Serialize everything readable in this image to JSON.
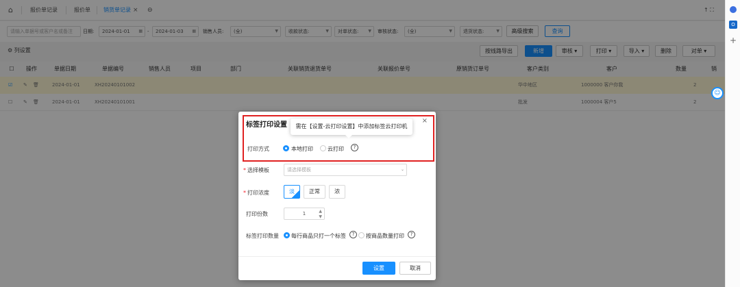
{
  "tabs": {
    "home": "⌂",
    "t1": "报价单记录",
    "t2": "报价单",
    "t3": "销货单记录",
    "close": "×",
    "add": "⊖",
    "right": "↑ ⛶"
  },
  "filter": {
    "search_placeholder": "请输入单据号或客户名或备注",
    "date_label": "日期:",
    "date_from": "2024-01-01",
    "date_sep": "-",
    "date_to": "2024-01-03",
    "sales_label": "销售人员:",
    "sales_value": "(全)",
    "collect_label": "收款状态:",
    "check_label": "对单状态:",
    "audit_label": "审核状态:",
    "audit_value": "(全)",
    "return_label": "退货状态:",
    "advanced": "高级搜索",
    "query": "查询"
  },
  "toolbar": {
    "col_settings": "列设置",
    "export": "按线路导出",
    "new": "新增",
    "audit": "审核",
    "print": "打印",
    "import": "导入",
    "delete": "删除",
    "check": "对单"
  },
  "table": {
    "headers": [
      "操作",
      "单据日期",
      "单据编号",
      "销售人员",
      "项目",
      "部门",
      "关联销货退货单号",
      "关联报价单号",
      "原销货订单号",
      "客户类别",
      "客户",
      "数量",
      "销"
    ],
    "rows": [
      {
        "date": "2024-01-01",
        "no": "XH20240101002",
        "ctype": "华中地区",
        "cust": "1000000 客户你我",
        "qty": "2"
      },
      {
        "date": "2024-01-01",
        "no": "XH20240101001",
        "ctype": "批发",
        "cust": "1000004 客户5",
        "qty": "2"
      }
    ]
  },
  "dialog": {
    "title": "标签打印设置",
    "tooltip": "需在【设置-云打印设置】中添加标签云打印机",
    "close": "×",
    "method_label": "打印方式",
    "local": "本地打印",
    "cloud": "云打印",
    "template_label": "选择模板",
    "template_placeholder": "请选择模板",
    "density_label": "打印浓度",
    "light": "淡",
    "normal": "正常",
    "dark": "浓",
    "copies_label": "打印份数",
    "copies": "1",
    "qty_label": "标签打印数量",
    "opt1": "每行商品只打一个标签",
    "opt2": "按商品数量打印",
    "setup": "设置",
    "cancel": "取消",
    "q": "?"
  },
  "colors": {
    "accent": "#1890ff",
    "highlight": "#fff8d6",
    "red": "#e02020"
  }
}
